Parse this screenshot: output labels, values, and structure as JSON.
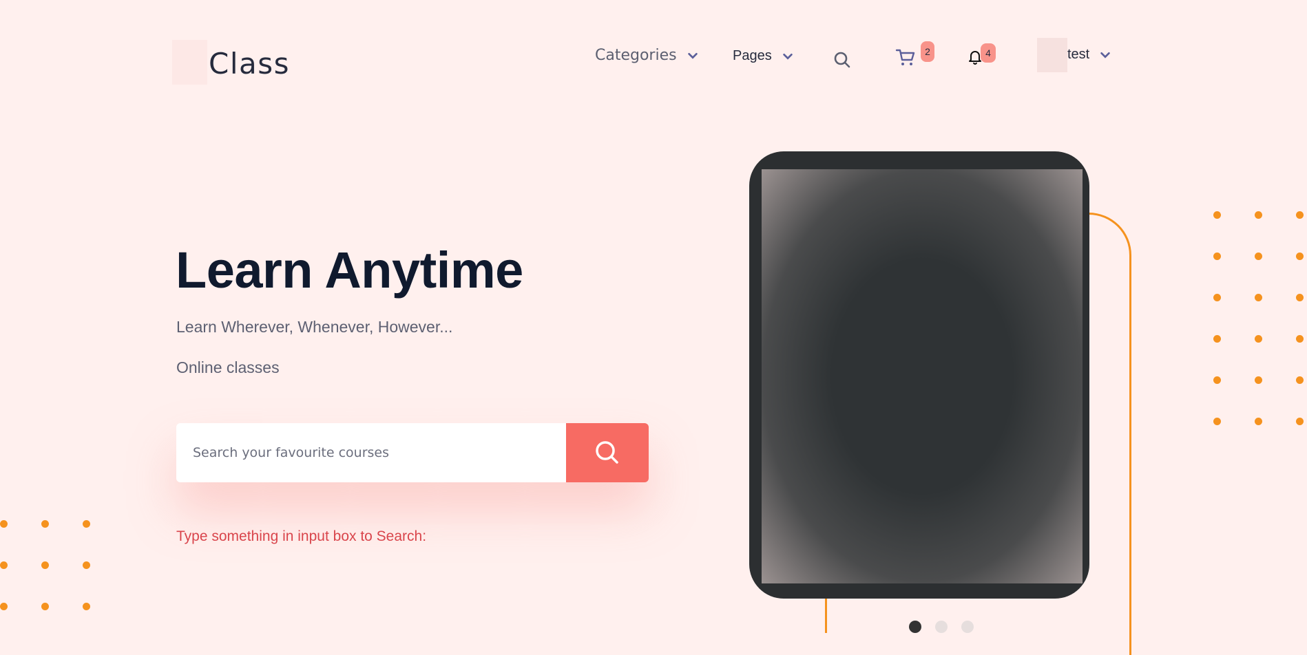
{
  "brand": {
    "name": "Class"
  },
  "nav": {
    "categories_label": "Categories",
    "pages_label": "Pages",
    "cart_count": "2",
    "notifications_count": "4",
    "user_name": "test"
  },
  "hero": {
    "title": "Learn Anytime",
    "subtitle": "Learn Wherever, Whenever, However...",
    "tagline": "Online classes",
    "search_placeholder": "Search your favourite courses",
    "hint": "Type something in input box to Search:"
  },
  "carousel": {
    "slides": 3,
    "active_index": 0
  },
  "colors": {
    "background": "#fff0ee",
    "accent": "#f76b63",
    "dots": "#f5921e",
    "hint": "#d9454c"
  },
  "icons": [
    "chevron-down-icon",
    "search-icon",
    "cart-icon",
    "bell-icon"
  ]
}
